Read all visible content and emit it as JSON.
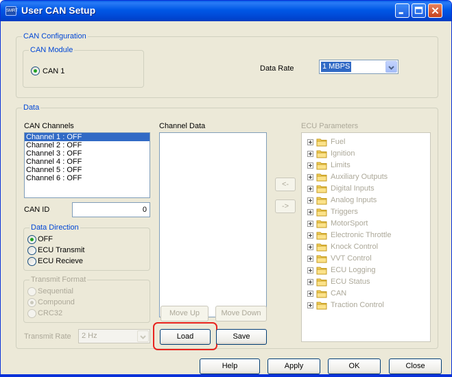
{
  "window": {
    "title": "User CAN Setup",
    "app_icon_text": "SMRT"
  },
  "can_configuration": {
    "legend": "CAN Configuration",
    "can_module": {
      "legend": "CAN Module",
      "option": "CAN 1"
    },
    "data_rate_label": "Data Rate",
    "data_rate_value": "1 MBPS"
  },
  "data": {
    "legend": "Data",
    "can_channels_label": "CAN Channels",
    "channels": [
      "Channel 1 : OFF",
      "Channel 2 : OFF",
      "Channel 3 : OFF",
      "Channel 4 : OFF",
      "Channel 5 : OFF",
      "Channel 6 : OFF"
    ],
    "can_id_label": "CAN ID",
    "can_id_value": "0",
    "data_direction": {
      "legend": "Data Direction",
      "options": [
        "OFF",
        "ECU Transmit",
        "ECU Recieve"
      ],
      "selected": "OFF"
    },
    "transmit_format": {
      "legend": "Transmit Format",
      "options": [
        "Sequential",
        "Compound",
        "CRC32"
      ],
      "selected": "Compound"
    },
    "transmit_rate_label": "Transmit Rate",
    "transmit_rate_value": "2 Hz",
    "channel_data_label": "Channel Data",
    "move_up": "Move Up",
    "move_down": "Move Down",
    "load": "Load",
    "save": "Save",
    "arrow_left": "<-",
    "arrow_right": "->",
    "ecu_parameters_label": "ECU Parameters",
    "ecu_parameters": [
      "Fuel",
      "Ignition",
      "Limits",
      "Auxiliary Outputs",
      "Digital Inputs",
      "Analog Inputs",
      "Triggers",
      "MotorSport",
      "Electronic Throttle",
      "Knock Control",
      "VVT Control",
      "ECU Logging",
      "ECU Status",
      "CAN",
      "Traction Control"
    ]
  },
  "footer": {
    "help": "Help",
    "apply": "Apply",
    "ok": "OK",
    "close": "Close"
  },
  "colors": {
    "title_bar": "#0058e6",
    "dialog_bg": "#ece9d8",
    "group_label": "#0046d5",
    "selection": "#316ac5",
    "load_highlight": "#e8231e"
  }
}
